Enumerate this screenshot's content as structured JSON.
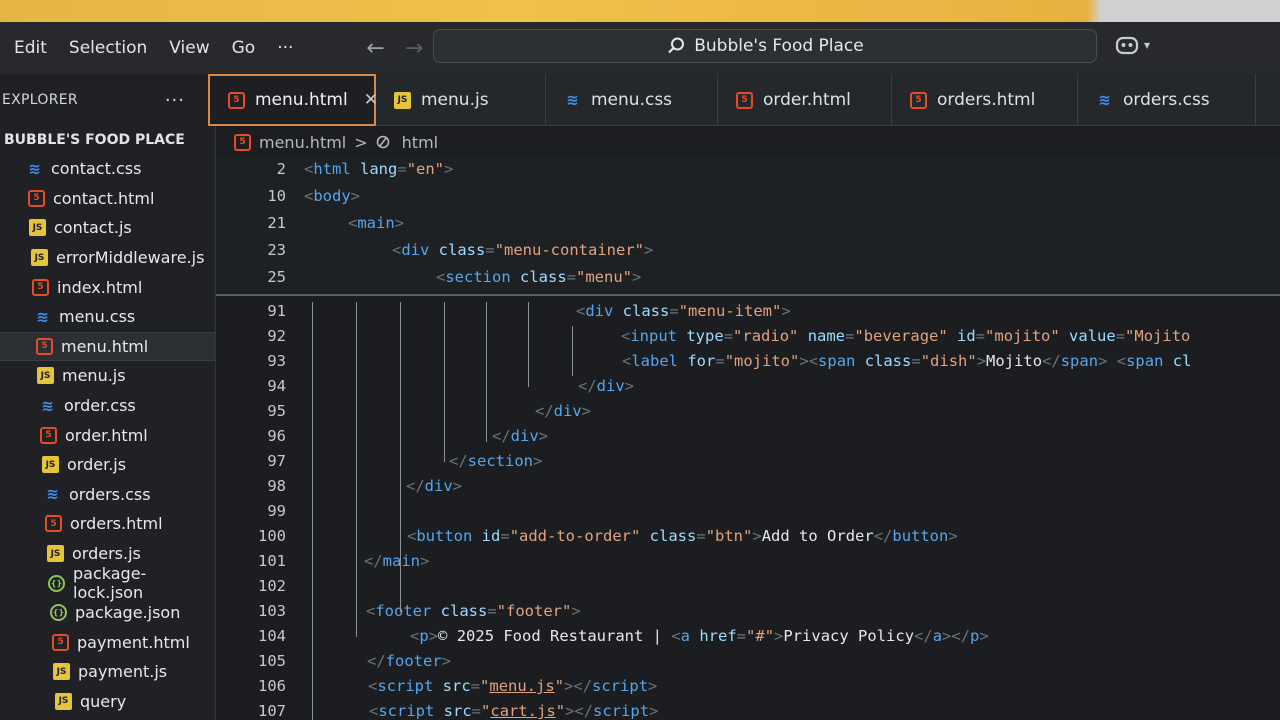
{
  "menu": [
    "Edit",
    "Selection",
    "View",
    "Go",
    "···"
  ],
  "search": {
    "title": "Bubble's Food Place"
  },
  "explorer": {
    "title": "EXPLORER",
    "more": "···",
    "folder": "BUBBLE'S FOOD PLACE"
  },
  "files": [
    {
      "name": "contact.css",
      "type": "css"
    },
    {
      "name": "contact.html",
      "type": "html"
    },
    {
      "name": "contact.js",
      "type": "js"
    },
    {
      "name": "errorMiddleware.js",
      "type": "js"
    },
    {
      "name": "index.html",
      "type": "html"
    },
    {
      "name": "menu.css",
      "type": "css"
    },
    {
      "name": "menu.html",
      "type": "html",
      "active": true
    },
    {
      "name": "menu.js",
      "type": "js"
    },
    {
      "name": "order.css",
      "type": "css"
    },
    {
      "name": "order.html",
      "type": "html"
    },
    {
      "name": "order.js",
      "type": "js"
    },
    {
      "name": "orders.css",
      "type": "css"
    },
    {
      "name": "orders.html",
      "type": "html"
    },
    {
      "name": "orders.js",
      "type": "js"
    },
    {
      "name": "package-lock.json",
      "type": "json"
    },
    {
      "name": "package.json",
      "type": "json"
    },
    {
      "name": "payment.html",
      "type": "html"
    },
    {
      "name": "payment.js",
      "type": "js"
    },
    {
      "name": "query",
      "type": "js"
    }
  ],
  "tabs": [
    {
      "label": "menu.html",
      "type": "html",
      "active": true
    },
    {
      "label": "menu.js",
      "type": "js"
    },
    {
      "label": "menu.css",
      "type": "css"
    },
    {
      "label": "order.html",
      "type": "html"
    },
    {
      "label": "orders.html",
      "type": "html"
    },
    {
      "label": "orders.css",
      "type": "css"
    }
  ],
  "breadcrumb": {
    "file": "menu.html",
    "sep": ">",
    "node": "html"
  },
  "sticky_lines": [
    {
      "n": "2",
      "indent": 0,
      "tokens": [
        [
          "tag",
          "<"
        ],
        [
          "name",
          "html"
        ],
        [
          "attr",
          " lang"
        ],
        [
          "tag",
          "="
        ],
        [
          "str",
          "\"en\""
        ],
        [
          "tag",
          ">"
        ]
      ]
    },
    {
      "n": "10",
      "indent": 0,
      "tokens": [
        [
          "tag",
          "<"
        ],
        [
          "name",
          "body"
        ],
        [
          "tag",
          ">"
        ]
      ]
    },
    {
      "n": "21",
      "indent": 1,
      "tokens": [
        [
          "tag",
          "<"
        ],
        [
          "name",
          "main"
        ],
        [
          "tag",
          ">"
        ]
      ]
    },
    {
      "n": "23",
      "indent": 2,
      "tokens": [
        [
          "tag",
          "<"
        ],
        [
          "name",
          "div"
        ],
        [
          "attr",
          " class"
        ],
        [
          "tag",
          "="
        ],
        [
          "str",
          "\"menu-container\""
        ],
        [
          "tag",
          ">"
        ]
      ]
    },
    {
      "n": "25",
      "indent": 3,
      "tokens": [
        [
          "tag",
          "<"
        ],
        [
          "name",
          "section"
        ],
        [
          "attr",
          " class"
        ],
        [
          "tag",
          "="
        ],
        [
          "str",
          "\"menu\""
        ],
        [
          "tag",
          ">"
        ]
      ]
    }
  ],
  "lines": [
    {
      "n": "91",
      "indent": 6,
      "tokens": [
        [
          "tag",
          "<"
        ],
        [
          "name",
          "div"
        ],
        [
          "attr",
          " class"
        ],
        [
          "tag",
          "="
        ],
        [
          "str",
          "\"menu-item\""
        ],
        [
          "tag",
          ">"
        ]
      ]
    },
    {
      "n": "92",
      "indent": 7,
      "tokens": [
        [
          "tag",
          "<"
        ],
        [
          "name",
          "input"
        ],
        [
          "attr",
          " type"
        ],
        [
          "tag",
          "="
        ],
        [
          "str",
          "\"radio\""
        ],
        [
          "attr",
          " name"
        ],
        [
          "tag",
          "="
        ],
        [
          "str",
          "\"beverage\""
        ],
        [
          "attr",
          " id"
        ],
        [
          "tag",
          "="
        ],
        [
          "str",
          "\"mojito\""
        ],
        [
          "attr",
          " value"
        ],
        [
          "tag",
          "="
        ],
        [
          "str",
          "\"Mojito"
        ]
      ]
    },
    {
      "n": "93",
      "indent": 7,
      "tokens": [
        [
          "tag",
          "<"
        ],
        [
          "name",
          "label"
        ],
        [
          "attr",
          " for"
        ],
        [
          "tag",
          "="
        ],
        [
          "str",
          "\"mojito\""
        ],
        [
          "tag",
          ">"
        ],
        [
          "tag",
          "<"
        ],
        [
          "name",
          "span"
        ],
        [
          "attr",
          " class"
        ],
        [
          "tag",
          "="
        ],
        [
          "str",
          "\"dish\""
        ],
        [
          "tag",
          ">"
        ],
        [
          "text",
          "Mojito"
        ],
        [
          "tag",
          "</"
        ],
        [
          "name",
          "span"
        ],
        [
          "tag",
          ">"
        ],
        [
          "text",
          " "
        ],
        [
          "tag",
          "<"
        ],
        [
          "name",
          "span"
        ],
        [
          "attr",
          " cl"
        ]
      ]
    },
    {
      "n": "94",
      "indent": 6,
      "tokens": [
        [
          "tag",
          "</"
        ],
        [
          "name",
          "div"
        ],
        [
          "tag",
          ">"
        ]
      ]
    },
    {
      "n": "95",
      "indent": 5,
      "tokens": [
        [
          "tag",
          "</"
        ],
        [
          "name",
          "div"
        ],
        [
          "tag",
          ">"
        ]
      ]
    },
    {
      "n": "96",
      "indent": 4,
      "tokens": [
        [
          "tag",
          "</"
        ],
        [
          "name",
          "div"
        ],
        [
          "tag",
          ">"
        ]
      ]
    },
    {
      "n": "97",
      "indent": 3,
      "tokens": [
        [
          "tag",
          "</"
        ],
        [
          "name",
          "section"
        ],
        [
          "tag",
          ">"
        ]
      ]
    },
    {
      "n": "98",
      "indent": 2,
      "tokens": [
        [
          "tag",
          "</"
        ],
        [
          "name",
          "div"
        ],
        [
          "tag",
          ">"
        ]
      ]
    },
    {
      "n": "99",
      "indent": 0,
      "tokens": []
    },
    {
      "n": "100",
      "indent": 2,
      "tokens": [
        [
          "tag",
          "<"
        ],
        [
          "name",
          "button"
        ],
        [
          "attr",
          " id"
        ],
        [
          "tag",
          "="
        ],
        [
          "str",
          "\"add-to-order\""
        ],
        [
          "attr",
          " class"
        ],
        [
          "tag",
          "="
        ],
        [
          "str",
          "\"btn\""
        ],
        [
          "tag",
          ">"
        ],
        [
          "text",
          "Add to Order"
        ],
        [
          "tag",
          "</"
        ],
        [
          "name",
          "button"
        ],
        [
          "tag",
          ">"
        ]
      ]
    },
    {
      "n": "101",
      "indent": 1,
      "tokens": [
        [
          "tag",
          "</"
        ],
        [
          "name",
          "main"
        ],
        [
          "tag",
          ">"
        ]
      ]
    },
    {
      "n": "102",
      "indent": 0,
      "tokens": []
    },
    {
      "n": "103",
      "indent": 1,
      "tokens": [
        [
          "tag",
          "<"
        ],
        [
          "name",
          "footer"
        ],
        [
          "attr",
          " class"
        ],
        [
          "tag",
          "="
        ],
        [
          "str",
          "\"footer\""
        ],
        [
          "tag",
          ">"
        ]
      ]
    },
    {
      "n": "104",
      "indent": 2,
      "tokens": [
        [
          "tag",
          "<"
        ],
        [
          "name",
          "p"
        ],
        [
          "tag",
          ">"
        ],
        [
          "text",
          "© 2025 Food Restaurant | "
        ],
        [
          "tag",
          "<"
        ],
        [
          "name",
          "a"
        ],
        [
          "attr",
          " href"
        ],
        [
          "tag",
          "="
        ],
        [
          "str",
          "\"#\""
        ],
        [
          "tag",
          ">"
        ],
        [
          "text",
          "Privacy Policy"
        ],
        [
          "tag",
          "</"
        ],
        [
          "name",
          "a"
        ],
        [
          "tag",
          "></"
        ],
        [
          "name",
          "p"
        ],
        [
          "tag",
          ">"
        ]
      ]
    },
    {
      "n": "105",
      "indent": 1,
      "tokens": [
        [
          "tag",
          "</"
        ],
        [
          "name",
          "footer"
        ],
        [
          "tag",
          ">"
        ]
      ]
    },
    {
      "n": "106",
      "indent": 1,
      "tokens": [
        [
          "tag",
          "<"
        ],
        [
          "name",
          "script"
        ],
        [
          "attr",
          " src"
        ],
        [
          "tag",
          "="
        ],
        [
          "str",
          "\""
        ],
        [
          "link",
          "menu.js"
        ],
        [
          "str",
          "\""
        ],
        [
          "tag",
          "></"
        ],
        [
          "name",
          "script"
        ],
        [
          "tag",
          ">"
        ]
      ]
    },
    {
      "n": "107",
      "indent": 1,
      "tokens": [
        [
          "tag",
          "<"
        ],
        [
          "name",
          "script"
        ],
        [
          "attr",
          " src"
        ],
        [
          "tag",
          "="
        ],
        [
          "str",
          "\""
        ],
        [
          "link",
          "cart.js"
        ],
        [
          "str",
          "\""
        ],
        [
          "tag",
          "></"
        ],
        [
          "name",
          "script"
        ],
        [
          "tag",
          ">"
        ]
      ]
    }
  ]
}
